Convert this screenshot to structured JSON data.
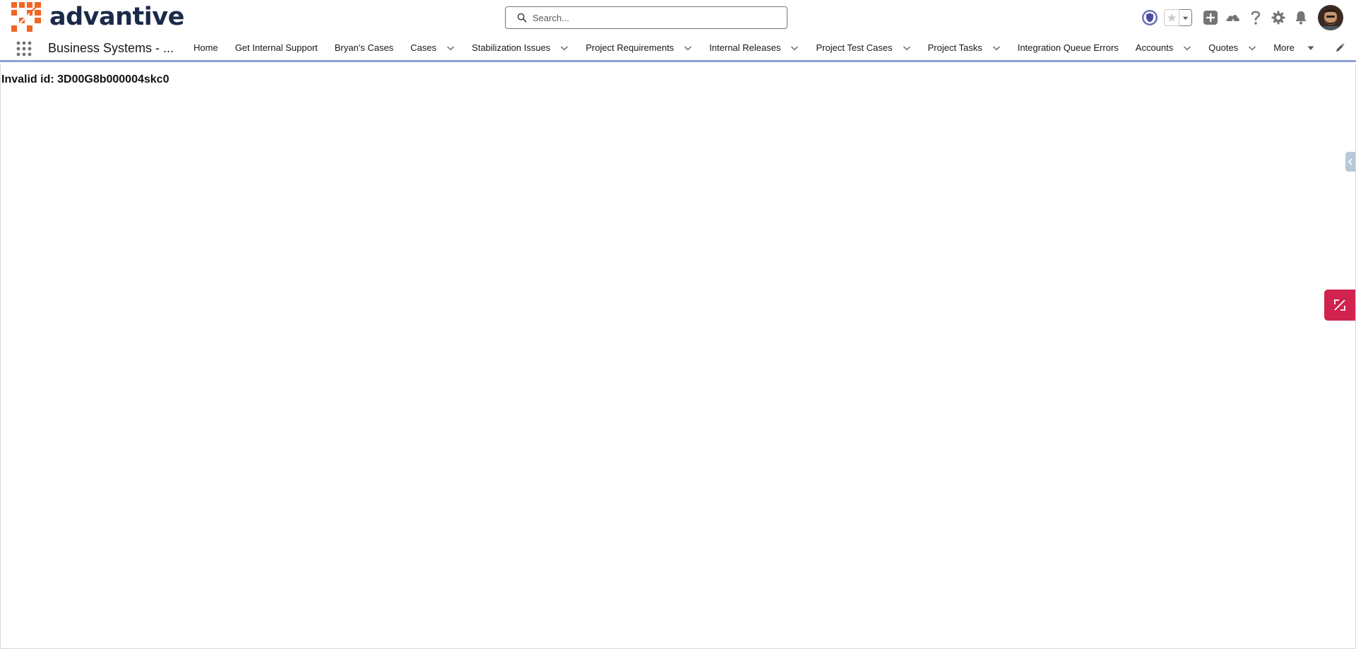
{
  "header": {
    "brand": "advantive",
    "search": {
      "placeholder": "Search...",
      "value": ""
    }
  },
  "nav": {
    "app_name": "Business Systems - ...",
    "items": [
      {
        "label": "Home",
        "dropdown": false
      },
      {
        "label": "Get Internal Support",
        "dropdown": false
      },
      {
        "label": "Bryan's Cases",
        "dropdown": false
      },
      {
        "label": "Cases",
        "dropdown": true
      },
      {
        "label": "Stabilization Issues",
        "dropdown": true
      },
      {
        "label": "Project Requirements",
        "dropdown": true
      },
      {
        "label": "Internal Releases",
        "dropdown": true
      },
      {
        "label": "Project Test Cases",
        "dropdown": true
      },
      {
        "label": "Project Tasks",
        "dropdown": true
      },
      {
        "label": "Integration Queue Errors",
        "dropdown": false
      },
      {
        "label": "Accounts",
        "dropdown": true
      },
      {
        "label": "Quotes",
        "dropdown": true
      }
    ],
    "more_label": "More"
  },
  "content": {
    "error_message": "Invalid id: 3D00G8b000004skc0"
  },
  "colors": {
    "brand_orange": "#f26522",
    "brand_navy": "#1b2a4a",
    "nav_underline": "#8e9fd8",
    "widget_red": "#d0234f"
  }
}
